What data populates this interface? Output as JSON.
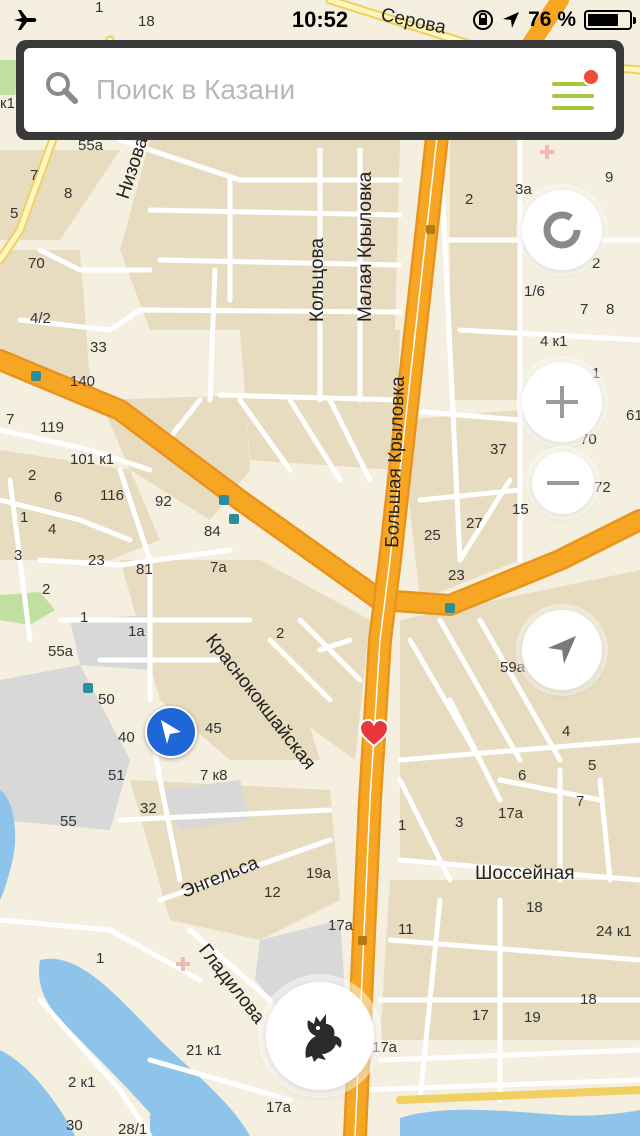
{
  "status": {
    "time": "10:52",
    "battery_text": "76 %",
    "battery_level": 0.76,
    "icons": [
      "airplane-mode-icon",
      "orientation-lock-icon",
      "location-arrow-icon",
      "battery-icon"
    ]
  },
  "search": {
    "placeholder": "Поиск в Казани",
    "icon": "search-icon",
    "menu_icon": "hamburger-menu-icon",
    "notification_dot_color": "#ef4d3a",
    "accent_color": "#a5c83a"
  },
  "controls": {
    "layers_icon": "traffic-ring-icon",
    "zoom_in_icon": "plus-icon",
    "zoom_out_icon": "minus-icon",
    "locate_icon": "navigation-arrow-icon",
    "logo_icon": "kazan-dragon-logo-icon"
  },
  "markers": {
    "user_location_color": "#1f66d6",
    "favorite_color": "#e8363f"
  },
  "map": {
    "colors": {
      "background": "#f4efde",
      "block": "#e7dcc0",
      "highway": "#f6a623",
      "road": "#ffffff",
      "water": "#8ec4ea",
      "industrial": "#d8d8d8",
      "park": "#bfe0a0"
    },
    "streets": {
      "serova": "Серова",
      "nizovaya": "Низовая",
      "koltsova": "Кольцова",
      "malaya_krylovka": "Малая Крыловка",
      "bolshaya_krylovka": "Большая Крыловка",
      "krasnokokshayskaya": "Краснококшайская",
      "engelsa": "Энгельса",
      "gladilova": "Гладилова",
      "shosseynaya": "Шоссейная"
    },
    "house_numbers": {
      "h18_top": "18",
      "h1_top": "1",
      "h1k1_left": "к1",
      "h55a_top": "55а",
      "h7_left": "7",
      "h8_left": "8",
      "h5_left": "5",
      "h70_left": "70",
      "h4_2": "4/2",
      "h33": "33",
      "h140": "140",
      "h7_mid": "7",
      "h119": "119",
      "h101k1": "101 к1",
      "h2_left": "2",
      "h6_left": "6",
      "h116": "116",
      "h92": "92",
      "h1_left": "1",
      "h4_left": "4",
      "h84": "84",
      "h3_left": "3",
      "h23_left": "23",
      "h81": "81",
      "h7a": "7а",
      "h2_left2": "2",
      "h1_mid": "1",
      "h1a": "1а",
      "h2_center": "2",
      "h55a": "55а",
      "h50": "50",
      "h40": "40",
      "h45": "45",
      "h51": "51",
      "h7k8": "7 к8",
      "h32": "32",
      "h55": "55",
      "h12": "12",
      "h19a": "19а",
      "h17a_mid": "17а",
      "h1_low": "1",
      "h21k1": "21 к1",
      "h2k1": "2 к1",
      "h30": "30",
      "h28_1": "28/1",
      "h17a_bottom": "17а",
      "h17a_logo": "17а",
      "h3a": "3а",
      "h9_right": "9",
      "h2_right": "2",
      "h2_right2": "2",
      "h1_6": "1/6",
      "h7_right": "7",
      "h8_right": "8",
      "h4k1_right": "4 к1",
      "h1_right": "1",
      "h61": "61",
      "h37": "37",
      "h70_right": "70",
      "h72": "72",
      "h15": "15",
      "h25": "25",
      "h27": "27",
      "h23_right": "23",
      "h59a": "59а",
      "h4_right": "4",
      "h5_right": "5",
      "h6_right": "6",
      "h7_right2": "7",
      "h17a_right": "17а",
      "h1_right2": "1",
      "h3_right": "3",
      "h18_right": "18",
      "h11": "11",
      "h24k1": "24 к1",
      "h18_right2": "18",
      "h17": "17",
      "h19": "19"
    }
  }
}
